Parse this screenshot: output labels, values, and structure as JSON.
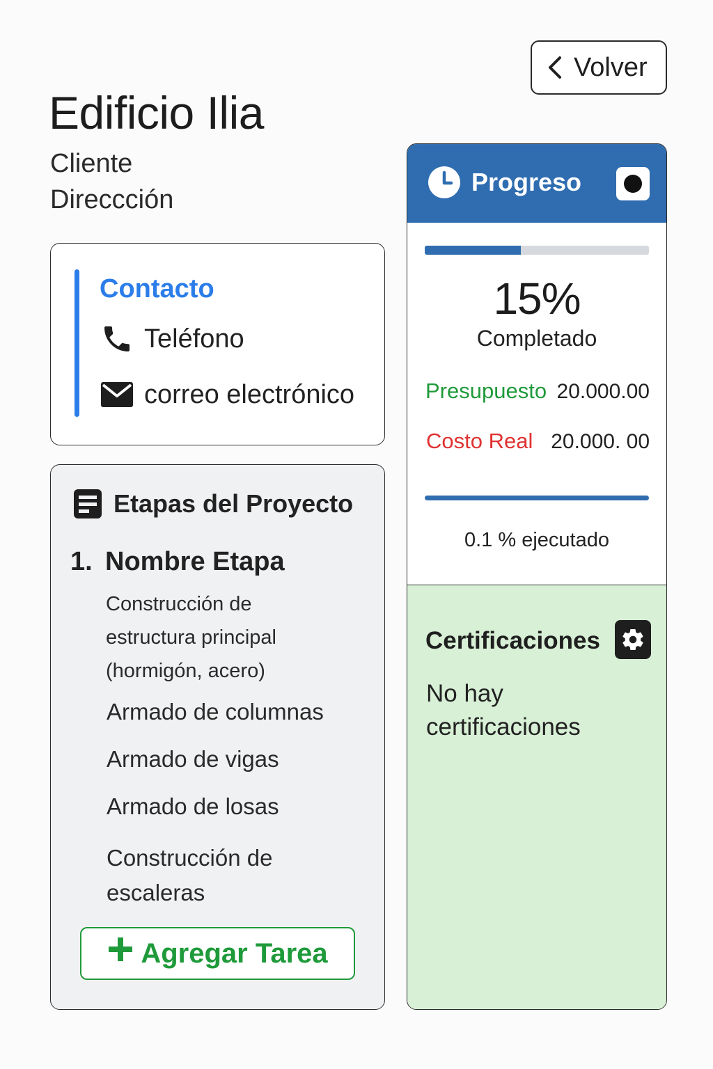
{
  "header": {
    "back_label": "Volver",
    "title": "Edificio Ilia",
    "client_label": "Cliente",
    "address_label": "Direccción"
  },
  "contact": {
    "title": "Contacto",
    "phone_label": "Teléfono",
    "email_label": "correo electrónico",
    "accent_color": "#2b7de9"
  },
  "stages": {
    "title": "Etapas del Proyecto",
    "items": [
      {
        "number": "1.",
        "name": "Nombre Etapa",
        "description": "Construcción de estructura principal (hormigón, acero)",
        "tasks": [
          "Armado de columnas",
          "Armado de vigas",
          "Armado de losas",
          "Construcción de escaleras"
        ]
      }
    ],
    "add_task_label": "Agregar Tarea",
    "add_task_icon": "plus-icon",
    "action_color": "#1f9a3a"
  },
  "progress": {
    "title": "Progreso",
    "header_color": "#2f6db0",
    "icons": [
      "clock-icon",
      "stop-icon"
    ],
    "bar_fraction": 0.43,
    "percent_text": "15%",
    "percent_label": "Completado",
    "budget_label": "Presupuesto",
    "budget_value": "20.000.00",
    "cost_label": "Costo Real",
    "cost_value": "20.000. 00",
    "exec_bar_fraction": 1.0,
    "exec_text": "0.1 % ejecutado"
  },
  "certifications": {
    "title": "Certificaciones",
    "icon": "gear-icon",
    "empty_text": "No hay certificaciones",
    "background_color": "#d8f0d6"
  }
}
